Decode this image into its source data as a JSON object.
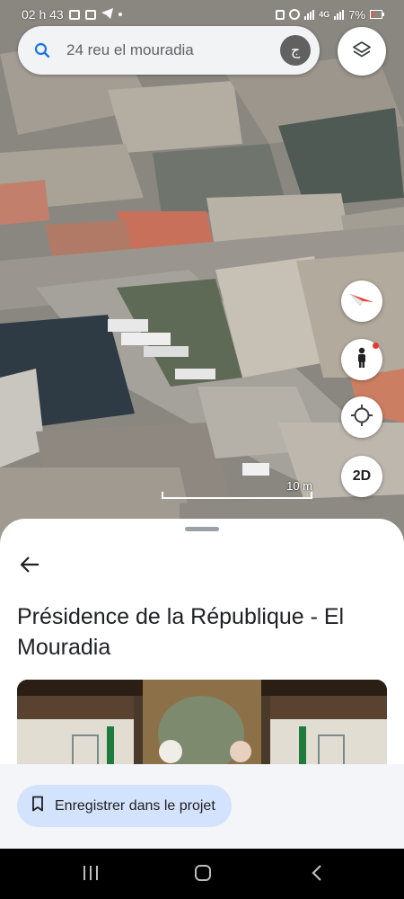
{
  "status_bar": {
    "time": "02 h 43",
    "network": "4G",
    "battery": "7%"
  },
  "search": {
    "value": "24 reu el mouradia",
    "avatar_letter": "ج"
  },
  "map": {
    "scale_label": "10 m",
    "dimension_toggle": "2D",
    "icons": [
      "search-icon",
      "layers-icon",
      "compass-icon",
      "pegman-icon",
      "my-location-icon"
    ]
  },
  "place": {
    "title": "Présidence de la République - El Mouradia"
  },
  "actions": {
    "save_label": "Enregistrer dans le projet"
  },
  "navigation": {
    "icons": [
      "recents-icon",
      "home-icon",
      "back-icon"
    ]
  },
  "colors": {
    "save_button_bg": "#d3e3fd",
    "sheet_bg": "#ffffff",
    "accent_blue": "#1a73e8"
  }
}
